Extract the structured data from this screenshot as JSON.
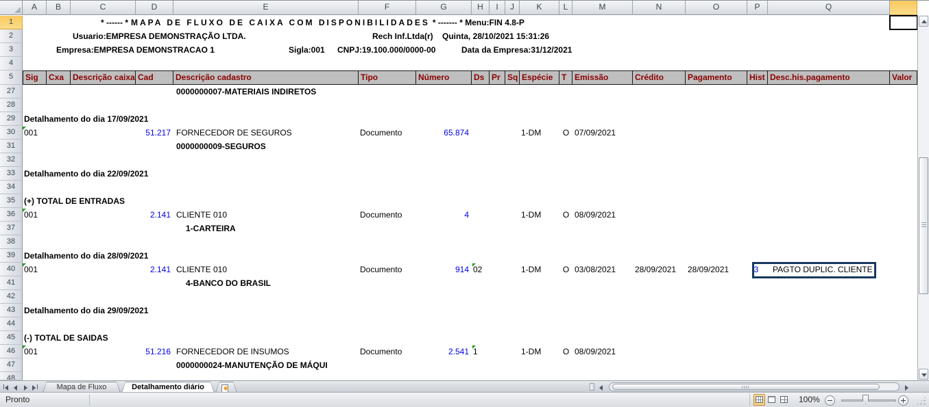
{
  "grid": {
    "column_letters": [
      "A",
      "B",
      "C",
      "D",
      "E",
      "F",
      "G",
      "H",
      "I",
      "J",
      "K",
      "L",
      "M",
      "N",
      "O",
      "P",
      "Q"
    ],
    "row_numbers": [
      "1",
      "2",
      "3",
      "4",
      "5",
      "27",
      "28",
      "29",
      "30",
      "31",
      "32",
      "33",
      "34",
      "35",
      "36",
      "37",
      "38",
      "39",
      "40",
      "41",
      "42",
      "43",
      "44",
      "45",
      "46",
      "47",
      "48"
    ]
  },
  "report": {
    "title": {
      "prefix": "* ------ *",
      "main": "MAPA DE FLUXO DE CAIXA COM DISPONIBILIDADES",
      "suffix": "* ------- *",
      "menu": "Menu:FIN 4.8-P"
    },
    "usuario": "Usuario:EMPRESA DEMONSTRAÇÃO LTDA.",
    "vendor": "Rech Inf.Ltda(r)",
    "datetime": "Quinta, 28/10/2021 15:31:26",
    "empresa": "Empresa:EMPRESA DEMONSTRACAO 1",
    "sigla": "Sigla:001",
    "cnpj": "CNPJ:19.100.000/0000-00",
    "data_empresa": "Data da Empresa:31/12/2021",
    "column_headers": [
      "Sig",
      "Cxa",
      "Descrição caixa",
      "Cad",
      "Descrição cadastro",
      "Tipo",
      "Número",
      "Ds",
      "Pr",
      "Sq",
      "Espécie",
      "T",
      "Emissão",
      "Crédito",
      "Pagamento",
      "Hist",
      "Desc.his.pagamento",
      "Valor"
    ],
    "cells": {
      "r27_e": "0000000007-MATERIAIS INDIRETOS",
      "r29_a": "Detalhamento do dia 17/09/2021",
      "r30_a": "001",
      "r30_d": "51.217",
      "r30_e": "FORNECEDOR DE SEGUROS",
      "r30_f": "Documento",
      "r30_g": "65.874",
      "r30_k": "1-DM",
      "r30_l": "O",
      "r30_m": "07/09/2021",
      "r31_e": "0000000009-SEGUROS",
      "r33_a": "Detalhamento do dia 22/09/2021",
      "r35_a": "(+) TOTAL DE ENTRADAS",
      "r36_a": "001",
      "r36_d": "2.141",
      "r36_e": "CLIENTE 010",
      "r36_f": "Documento",
      "r36_g": "4",
      "r36_k": "1-DM",
      "r36_l": "O",
      "r36_m": "08/09/2021",
      "r37_e": "1-CARTEIRA",
      "r39_a": "Detalhamento do dia 28/09/2021",
      "r40_a": "001",
      "r40_d": "2.141",
      "r40_e": "CLIENTE 010",
      "r40_f": "Documento",
      "r40_g": "914",
      "r40_h": "02",
      "r40_k": "1-DM",
      "r40_l": "O",
      "r40_m": "03/08/2021",
      "r40_n": "28/09/2021",
      "r40_o": "28/09/2021",
      "r40_p": "3",
      "r40_q": "PAGTO DUPLIC. CLIENTE",
      "r41_e": "4-BANCO DO BRASIL",
      "r43_a": "Detalhamento do dia 29/09/2021",
      "r45_a": "(-) TOTAL DE SAIDAS",
      "r46_a": "001",
      "r46_d": "51.216",
      "r46_e": "FORNECEDOR DE INSUMOS",
      "r46_f": "Documento",
      "r46_g": "2.541",
      "r46_h": "1",
      "r46_k": "1-DM",
      "r46_l": "O",
      "r46_m": "08/09/2021",
      "r47_e": "0000000024-MANUTENÇÃO DE MÁQUI"
    }
  },
  "tabs": {
    "sheet1": "Mapa de Fluxo",
    "sheet2": "Detalhamento diário"
  },
  "statusbar": {
    "status": "Pronto",
    "zoom": "100%"
  },
  "colors": {
    "band_bg": "#BFBFBF",
    "band_text": "#8B0000",
    "link_blue": "#0000EE",
    "selection_amber": "#F9C95F",
    "highlight_box_border": "#17375E",
    "error_marker_green": "#1E9B1E"
  }
}
